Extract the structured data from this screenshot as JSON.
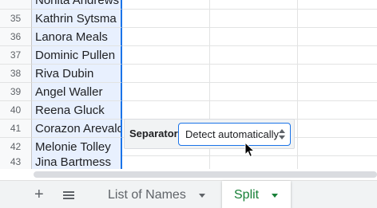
{
  "grid": {
    "partial_top_text": "Nonita Andrews",
    "rows": [
      {
        "num": "35",
        "name": "Kathrin Sytsma"
      },
      {
        "num": "36",
        "name": "Lanora Meals"
      },
      {
        "num": "37",
        "name": "Dominic Pullen"
      },
      {
        "num": "38",
        "name": "Riva Dubin"
      },
      {
        "num": "39",
        "name": "Angel Waller"
      },
      {
        "num": "40",
        "name": "Reena Gluck"
      },
      {
        "num": "41",
        "name": "Corazon Arevalo"
      },
      {
        "num": "42",
        "name": "Melonie Tolley"
      },
      {
        "num": "43",
        "name": "Jina Bartmess"
      }
    ]
  },
  "split_text_to_columns": {
    "separator_label": "Separator:",
    "selected_option": "Detect automatically"
  },
  "sheet_tabs": {
    "add_icon": "plus-icon",
    "all_sheets_icon": "list-icon",
    "tabs": [
      {
        "label": "List of Names",
        "active": false
      },
      {
        "label": "Split",
        "active": true
      }
    ]
  },
  "colors": {
    "selection_fill": "#e8f0fe",
    "selection_border": "#1a73e8",
    "active_tab_text": "#188038"
  }
}
